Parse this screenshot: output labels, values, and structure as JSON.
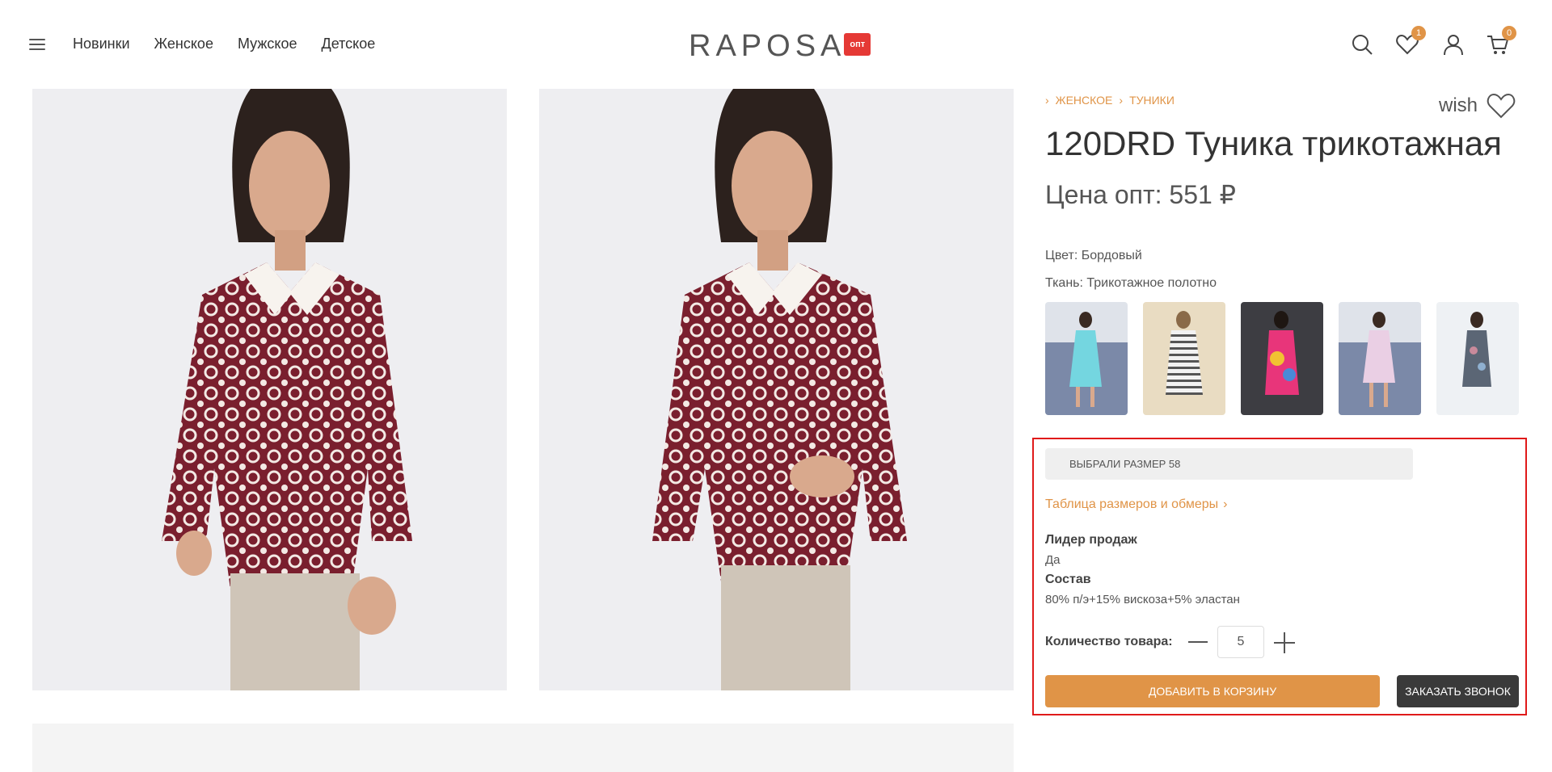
{
  "header": {
    "menu_icon": "hamburger-icon",
    "nav": [
      "Новинки",
      "Женское",
      "Мужское",
      "Детское"
    ],
    "logo": {
      "text": "RAPOSA",
      "badge": "опт",
      "badge_color": "#e53935"
    },
    "icons": {
      "search": "search-icon",
      "wishlist": {
        "icon": "heart-icon",
        "count": "1"
      },
      "account": "user-icon",
      "cart": {
        "icon": "cart-icon",
        "count": "0"
      }
    }
  },
  "product": {
    "breadcrumbs": [
      "ЖЕНСКОЕ",
      "ТУНИКИ"
    ],
    "wish_label": "wish",
    "title": "120DRD Туника трикотажная",
    "price": "Цена опт: 551 ₽",
    "color": "Цвет: Бордовый",
    "fabric": "Ткань: Трикотажное полотно",
    "thumbnails": [
      "turquoise-dress",
      "striped-dress",
      "pink-print-dress",
      "lilac-dress",
      "grey-print-dress"
    ],
    "size_selected": "ВЫБРАЛИ РАЗМЕР 58",
    "size_table_link": "Таблица размеров и обмеры",
    "specs": [
      {
        "label": "Лидер продаж",
        "value": "Да"
      },
      {
        "label": "Состав",
        "value": "80% п/э+15% вискоза+5% эластан"
      }
    ],
    "quantity_label": "Количество товара:",
    "quantity": "5",
    "add_to_cart": "ДОБАВИТЬ В КОРЗИНУ",
    "order_call": "ЗАКАЗАТЬ ЗВОНОК"
  },
  "colors": {
    "accent": "#e09447",
    "dark_button": "#3a3a3a",
    "highlight": "#e01a1a",
    "garment": "#7a1f2e"
  }
}
